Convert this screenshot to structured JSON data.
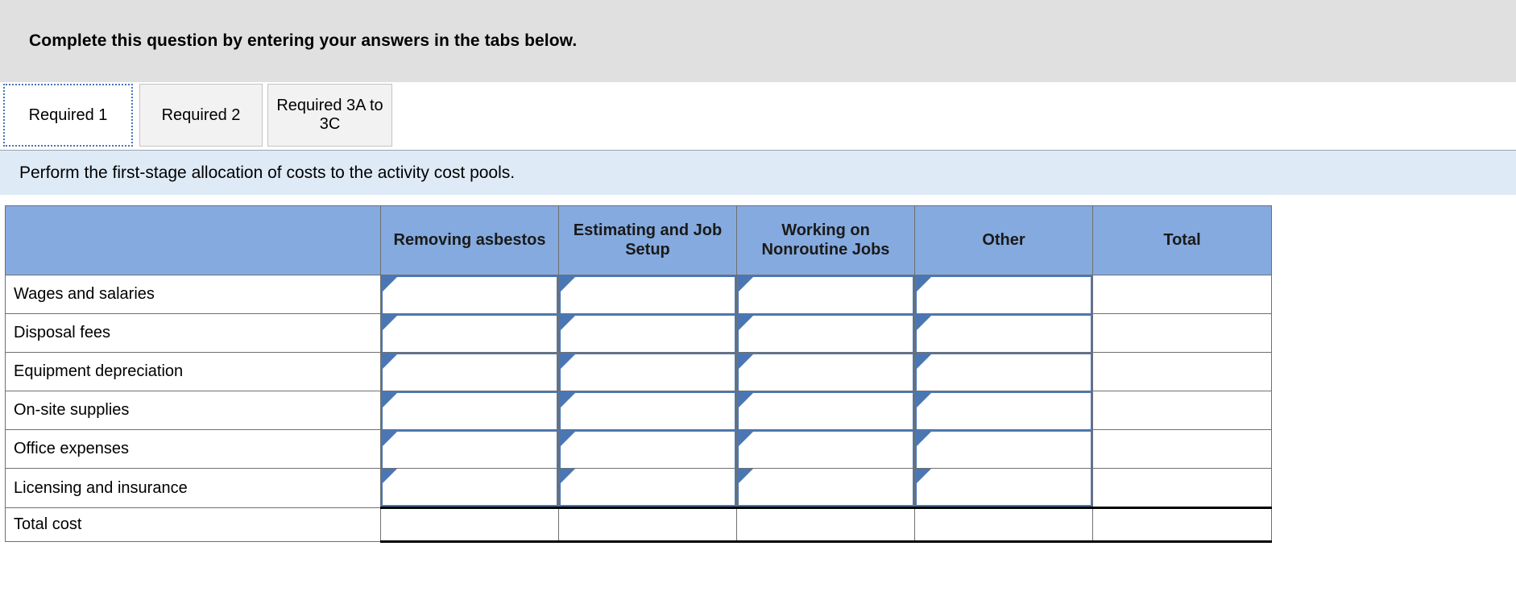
{
  "banner": {
    "text": "Complete this question by entering your answers in the tabs below."
  },
  "tabs": [
    {
      "label": "Required 1",
      "active": true
    },
    {
      "label": "Required 2",
      "active": false
    },
    {
      "label": "Required 3A to 3C",
      "active": false
    }
  ],
  "instruction": {
    "text": "Perform the first-stage allocation of costs to the activity cost pools."
  },
  "colors": {
    "banner_bg": "#e0e0e0",
    "instruction_bg": "#deeaf6",
    "table_header_bg": "#85aadf",
    "input_border": "#4a77b4",
    "grid_border": "#6f6f6f",
    "tab_active_focus": "#4874b8"
  },
  "chart_data": {
    "type": "table",
    "title": "First-stage allocation of costs to activity cost pools",
    "columns": [
      "",
      "Removing asbestos",
      "Estimating and Job Setup",
      "Working on Nonroutine Jobs",
      "Other",
      "Total"
    ],
    "rows": [
      {
        "label": "Wages and salaries",
        "cells": [
          "",
          "",
          "",
          ""
        ],
        "total": "",
        "input": true
      },
      {
        "label": "Disposal fees",
        "cells": [
          "",
          "",
          "",
          ""
        ],
        "total": "",
        "input": true
      },
      {
        "label": "Equipment depreciation",
        "cells": [
          "",
          "",
          "",
          ""
        ],
        "total": "",
        "input": true
      },
      {
        "label": "On-site supplies",
        "cells": [
          "",
          "",
          "",
          ""
        ],
        "total": "",
        "input": true
      },
      {
        "label": "Office expenses",
        "cells": [
          "",
          "",
          "",
          ""
        ],
        "total": "",
        "input": true
      },
      {
        "label": "Licensing and insurance",
        "cells": [
          "",
          "",
          "",
          ""
        ],
        "total": "",
        "input": true
      },
      {
        "label": "Total cost",
        "cells": [
          "",
          "",
          "",
          ""
        ],
        "total": "",
        "input": false
      }
    ]
  }
}
